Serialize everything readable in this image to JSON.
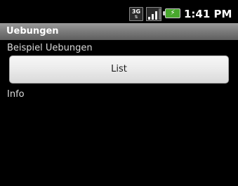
{
  "status_bar": {
    "network_type": "3G",
    "signal_icon": "signal-strength-icon",
    "signal_level": 0.75,
    "battery_icon": "battery-charging-icon",
    "time": "1:41 PM"
  },
  "app": {
    "title": "Uebungen"
  },
  "main": {
    "header_label": "Beispiel Uebungen",
    "list_button_label": "List",
    "info_label": "Info"
  },
  "colors": {
    "background": "#000000",
    "title_bar": "#7a7a7a",
    "button_face": "#ececec",
    "battery": "#48a72d"
  }
}
